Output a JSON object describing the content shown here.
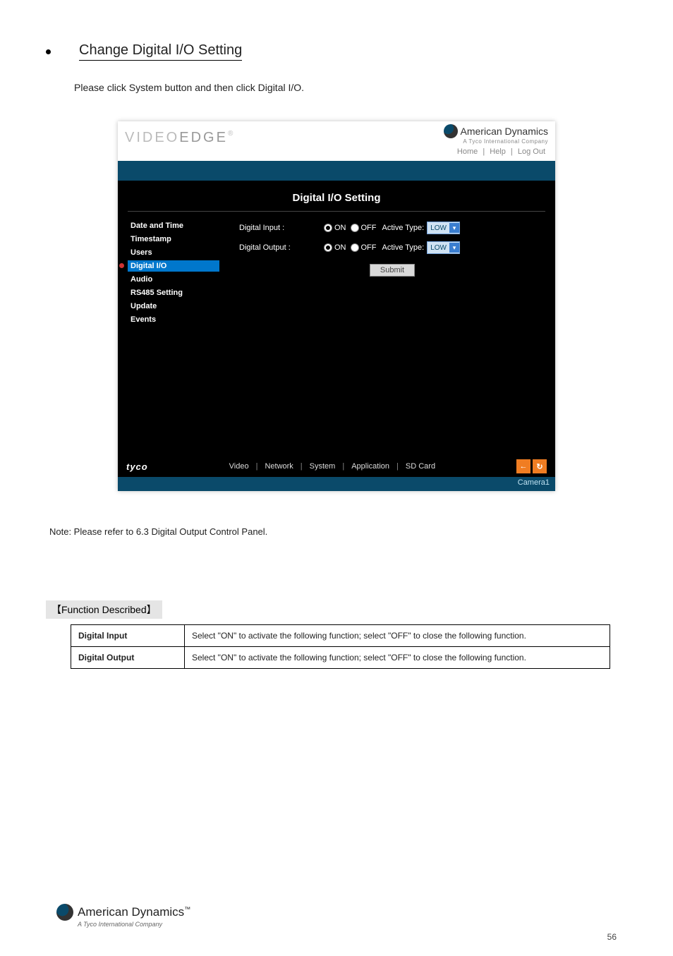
{
  "doc": {
    "section_title": "Change Digital I/O Setting",
    "instruction": "Please click System button and then click Digital I/O.",
    "note": "Note: Please refer to 6.3 Digital Output Control Panel.",
    "func_heading": "【Function Described】",
    "page_number": "56"
  },
  "app": {
    "logo_left_a": "VIDEO",
    "logo_left_b": "EDGE",
    "brand_name": "American Dynamics",
    "brand_sub": "A Tyco International Company",
    "header_links": {
      "home": "Home",
      "help": "Help",
      "logout": "Log Out"
    },
    "panel_title": "Digital I/O Setting",
    "sidebar": {
      "items": [
        "Date and Time",
        "Timestamp",
        "Users",
        "Digital I/O",
        "Audio",
        "RS485 Setting",
        "Update",
        "Events"
      ],
      "active_index": 3
    },
    "form": {
      "rows": [
        {
          "label": "Digital Input  :",
          "on": "ON",
          "off": "OFF",
          "active_label": "Active Type:",
          "select_value": "LOW",
          "on_checked": true
        },
        {
          "label": "Digital Output :",
          "on": "ON",
          "off": "OFF",
          "active_label": "Active Type:",
          "select_value": "LOW",
          "on_checked": true
        }
      ],
      "submit": "Submit"
    },
    "bottom_tabs": [
      "Video",
      "Network",
      "System",
      "Application",
      "SD Card"
    ],
    "camera_label": "Camera1",
    "tyco": "tyco"
  },
  "table": {
    "rows": [
      {
        "c1": "Digital Input",
        "c2": "Select \"ON\" to activate the following function; select \"OFF\" to close the following function."
      },
      {
        "c1": "Digital Output",
        "c2": "Select \"ON\" to activate the following function; select \"OFF\" to close the following function."
      }
    ]
  },
  "footer": {
    "brand": "American Dynamics",
    "tm": "™",
    "sub": "A Tyco International Company"
  }
}
